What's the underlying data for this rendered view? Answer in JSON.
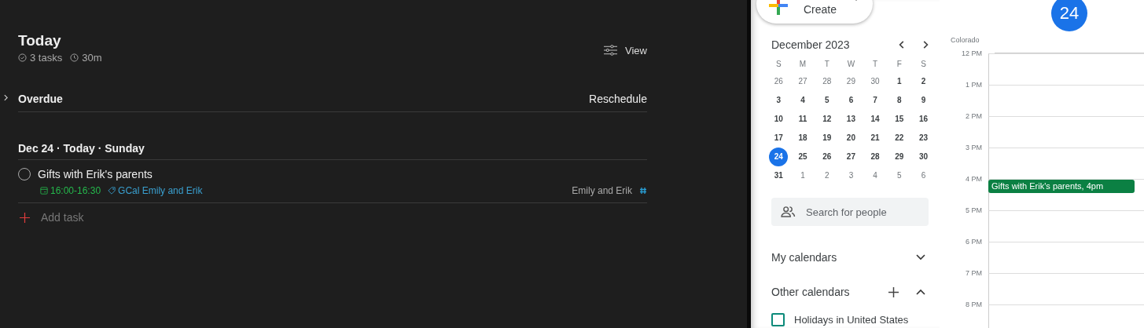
{
  "todo": {
    "title": "Today",
    "task_count": "3 tasks",
    "duration": "30m",
    "view_button": "View",
    "overdue": {
      "label": "Overdue",
      "expanded": false,
      "action": "Reschedule"
    },
    "section": {
      "heading": "Dec 24 · Today · Sunday",
      "tasks": [
        {
          "title": "Gifts with Erik's parents",
          "completed": false,
          "time": "16:00-16:30",
          "label": "GCal Emily and Erik",
          "project": "Emily and Erik"
        }
      ]
    },
    "add_task": "Add task"
  },
  "calendar": {
    "create_button": "Create",
    "month": "December 2023",
    "weekdays": [
      "S",
      "M",
      "T",
      "W",
      "T",
      "F",
      "S"
    ],
    "weeks": [
      [
        {
          "day": "26",
          "muted": true,
          "selected": false
        },
        {
          "day": "27",
          "muted": true,
          "selected": false
        },
        {
          "day": "28",
          "muted": true,
          "selected": false
        },
        {
          "day": "29",
          "muted": true,
          "selected": false
        },
        {
          "day": "30",
          "muted": true,
          "selected": false
        },
        {
          "day": "1",
          "muted": false,
          "selected": false
        },
        {
          "day": "2",
          "muted": false,
          "selected": false
        }
      ],
      [
        {
          "day": "3",
          "muted": false,
          "selected": false
        },
        {
          "day": "4",
          "muted": false,
          "selected": false
        },
        {
          "day": "5",
          "muted": false,
          "selected": false
        },
        {
          "day": "6",
          "muted": false,
          "selected": false
        },
        {
          "day": "7",
          "muted": false,
          "selected": false
        },
        {
          "day": "8",
          "muted": false,
          "selected": false
        },
        {
          "day": "9",
          "muted": false,
          "selected": false
        }
      ],
      [
        {
          "day": "10",
          "muted": false,
          "selected": false
        },
        {
          "day": "11",
          "muted": false,
          "selected": false
        },
        {
          "day": "12",
          "muted": false,
          "selected": false
        },
        {
          "day": "13",
          "muted": false,
          "selected": false
        },
        {
          "day": "14",
          "muted": false,
          "selected": false
        },
        {
          "day": "15",
          "muted": false,
          "selected": false
        },
        {
          "day": "16",
          "muted": false,
          "selected": false
        }
      ],
      [
        {
          "day": "17",
          "muted": false,
          "selected": false
        },
        {
          "day": "18",
          "muted": false,
          "selected": false
        },
        {
          "day": "19",
          "muted": false,
          "selected": false
        },
        {
          "day": "20",
          "muted": false,
          "selected": false
        },
        {
          "day": "21",
          "muted": false,
          "selected": false
        },
        {
          "day": "22",
          "muted": false,
          "selected": false
        },
        {
          "day": "23",
          "muted": false,
          "selected": false
        }
      ],
      [
        {
          "day": "24",
          "muted": false,
          "selected": true
        },
        {
          "day": "25",
          "muted": false,
          "selected": false
        },
        {
          "day": "26",
          "muted": false,
          "selected": false
        },
        {
          "day": "27",
          "muted": false,
          "selected": false
        },
        {
          "day": "28",
          "muted": false,
          "selected": false
        },
        {
          "day": "29",
          "muted": false,
          "selected": false
        },
        {
          "day": "30",
          "muted": false,
          "selected": false
        }
      ],
      [
        {
          "day": "31",
          "muted": false,
          "selected": false
        },
        {
          "day": "1",
          "muted": true,
          "selected": false
        },
        {
          "day": "2",
          "muted": true,
          "selected": false
        },
        {
          "day": "3",
          "muted": true,
          "selected": false
        },
        {
          "day": "4",
          "muted": true,
          "selected": false
        },
        {
          "day": "5",
          "muted": true,
          "selected": false
        },
        {
          "day": "6",
          "muted": true,
          "selected": false
        }
      ]
    ],
    "search": {
      "placeholder": "Search for people"
    },
    "my_calendars": {
      "label": "My calendars",
      "expanded": false
    },
    "other_calendars": {
      "label": "Other calendars",
      "expanded": true,
      "items": [
        {
          "label": "Holidays in United States",
          "checked": false,
          "color": "#0b8a7a"
        }
      ]
    },
    "day_view": {
      "date": "24",
      "timezone": "Colorado",
      "hours": [
        {
          "label": "12 PM"
        },
        {
          "label": "1 PM"
        },
        {
          "label": "2 PM"
        },
        {
          "label": "3 PM"
        },
        {
          "label": "4 PM",
          "events": [
            {
              "title": "Gifts with Erik's parents, 4pm",
              "color": "#0b8043"
            }
          ]
        },
        {
          "label": "5 PM"
        },
        {
          "label": "6 PM"
        },
        {
          "label": "7 PM"
        },
        {
          "label": "8 PM"
        }
      ]
    }
  }
}
